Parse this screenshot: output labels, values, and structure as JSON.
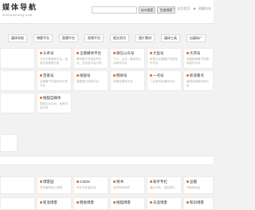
{
  "header": {
    "logo_title": "媒体导航",
    "logo_subtitle": "meitidaohang.com",
    "search_placeholder": "",
    "search_site_label": "站内搜索",
    "search_baidu_label": "百度搜索",
    "right_links": [
      "设为首页",
      "收藏本站"
    ]
  },
  "categories": [
    "媒体导航",
    "博客平台",
    "直播平台",
    "视频平台",
    "图文资讯",
    "图片素材",
    "媒体工具",
    "自媒体广"
  ],
  "cards_row1": [
    {
      "title": "",
      "desc": "",
      "dot_color": "#e8743b"
    },
    {
      "title": "头条号",
      "desc": "今日头条媒体平台，优质内容推荐分发",
      "dot_color": "#e8743b"
    },
    {
      "title": "企鹅媒体平台",
      "desc": "腾讯旗下内容创作平台，支持多平台分发",
      "dot_color": "#e8743b"
    },
    {
      "title": "微信公众号",
      "desc": "个人、企业、媒体的公众账号平台",
      "dot_color": "#e8743b"
    },
    {
      "title": "大鱼号",
      "desc": "阿里大文娱旗下内容创作平台",
      "dot_color": "#e8743b"
    },
    {
      "title": "大风号",
      "desc": "凤凰新闻旗下自媒体创作平台",
      "dot_color": "#e8743b"
    }
  ],
  "cards_row2": [
    {
      "title": "",
      "desc": "",
      "dot_color": "#e8743b"
    },
    {
      "title": "百家号",
      "desc": "百度旗下内容创作分发平台",
      "dot_color": "#e8743b"
    },
    {
      "title": "搜狐号",
      "desc": "搜狐旗下内容平台",
      "dot_color": "#e8743b"
    },
    {
      "title": "网易号",
      "desc": "网易自媒体平台",
      "dot_color": "#e8743b"
    },
    {
      "title": "一点号",
      "desc": "一点资讯自媒体平台",
      "dot_color": "#e8743b"
    },
    {
      "title": "新浪看点",
      "desc": "新浪自媒体内容平台",
      "dot_color": "#e8743b"
    }
  ],
  "card_single": {
    "title": "搜狐自媒体",
    "desc": "搜狐公众平台，优质内容分发",
    "dot_color": "#e8743b"
  },
  "small_note": "",
  "bottom_row1": [
    {
      "title": "",
      "desc": "",
      "dot_color": "#e8743b"
    },
    {
      "title": "博客园",
      "desc": "开发者的网上家园",
      "dot_color": "#e8743b"
    },
    {
      "title": "CSDN",
      "desc": "专业开发者社区",
      "dot_color": "#e8743b"
    },
    {
      "title": "简书",
      "desc": "创作你的创作",
      "dot_color": "#e8743b"
    },
    {
      "title": "知乎专栏",
      "desc": "随心写作，自由表达",
      "dot_color": "#e8743b"
    },
    {
      "title": "豆瓣",
      "desc": "书影音社区",
      "dot_color": "#e8743b"
    }
  ],
  "bottom_row2": [
    {
      "title": "",
      "desc": "",
      "dot_color": "#e8743b"
    },
    {
      "title": "新浪博客",
      "desc": "",
      "dot_color": "#e8743b"
    },
    {
      "title": "网易博客",
      "desc": "",
      "dot_color": "#e8743b"
    },
    {
      "title": "搜狐博客",
      "desc": "",
      "dot_color": "#e8743b"
    },
    {
      "title": "天涯博客",
      "desc": "",
      "dot_color": "#e8743b"
    },
    {
      "title": "和讯博客",
      "desc": "",
      "dot_color": "#e8743b"
    }
  ]
}
